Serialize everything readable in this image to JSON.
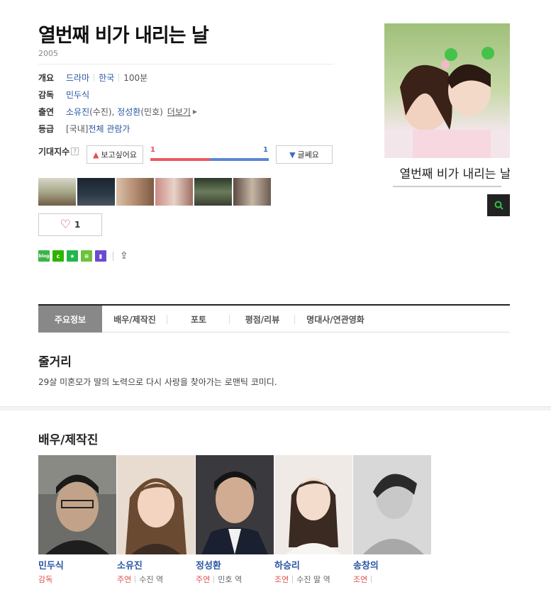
{
  "movie": {
    "title": "열번째 비가 내리는 날",
    "year": "2005"
  },
  "info": {
    "overview_label": "개요",
    "genre": "드라마",
    "country": "한국",
    "runtime": "100분",
    "director_label": "감독",
    "director": "민두식",
    "cast_label": "출연",
    "cast_1": "소유진",
    "cast_1_role": "(수진)",
    "cast_2": "정성환",
    "cast_2_role": "(민호)",
    "more_label": "더보기",
    "rating_label": "등급",
    "rating_prefix": "[국내]",
    "rating_value": "전체 관람가"
  },
  "expectation": {
    "label": "기대지수",
    "help": "?",
    "want_label": "보고싶어요",
    "want_count": "1",
    "no_label": "글쎄요",
    "no_count": "1",
    "want_fraction": 0.5
  },
  "like": {
    "count": "1"
  },
  "share_icons": [
    {
      "name": "blog-share-icon",
      "text": "blog",
      "color": "#3cb44a"
    },
    {
      "name": "cafe-share-icon",
      "text": "c",
      "color": "#2db400"
    },
    {
      "name": "bookmark-share-icon",
      "text": "★",
      "color": "#20b74a"
    },
    {
      "name": "memo-share-icon",
      "text": "≡",
      "color": "#6cc23a"
    },
    {
      "name": "band-share-icon",
      "text": "▮",
      "color": "#6b4bd1"
    }
  ],
  "poster": {
    "caption": "열번째 비가 내리는 날"
  },
  "tabs": [
    "주요정보",
    "배우/제작진",
    "포토",
    "평점/리뷰",
    "명대사/연관영화"
  ],
  "synopsis": {
    "title": "줄거리",
    "text": "29살 미혼모가 딸의 노력으로 다시 사랑을 찾아가는 로맨틱 코미디."
  },
  "cast_section": {
    "title": "배우/제작진",
    "people": [
      {
        "name": "민두식",
        "role": "감독",
        "character": ""
      },
      {
        "name": "소유진",
        "role": "주연",
        "character": "수진 역"
      },
      {
        "name": "정성환",
        "role": "주연",
        "character": "민호 역"
      },
      {
        "name": "하승리",
        "role": "조연",
        "character": "수진 딸 역"
      },
      {
        "name": "송창의",
        "role": "조연",
        "character": ""
      }
    ]
  }
}
